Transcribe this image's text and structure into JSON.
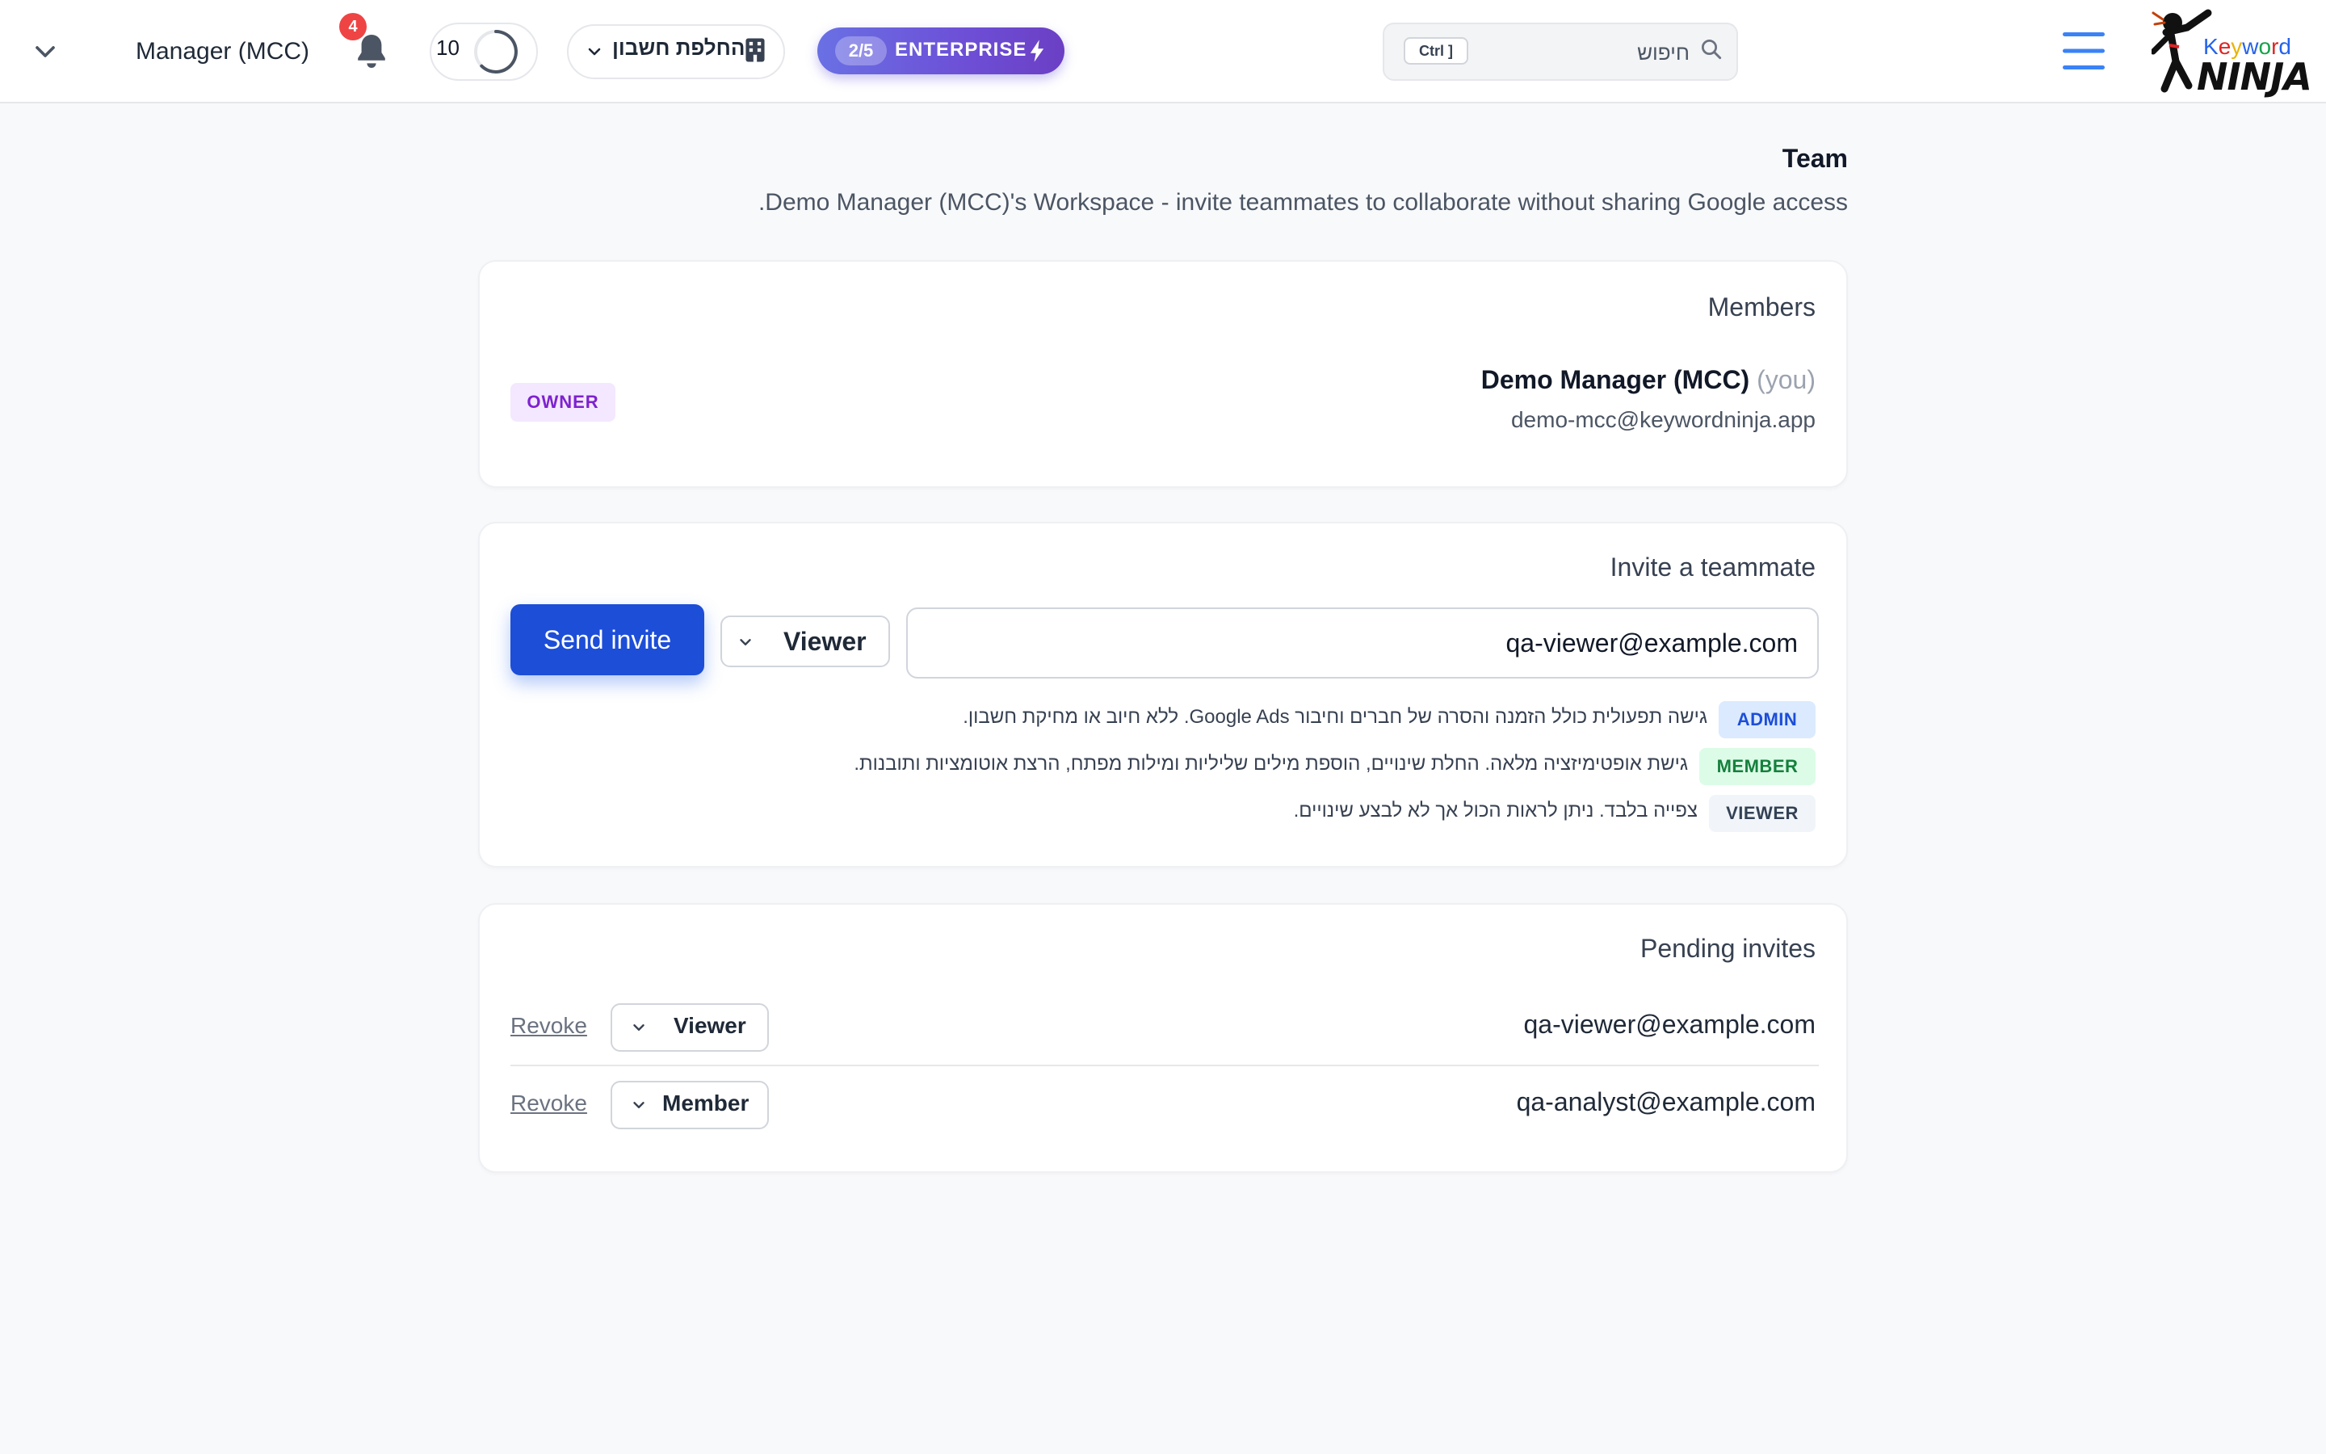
{
  "header": {
    "account_name": "Manager (MCC)",
    "notification_count": "4",
    "credits_value": "10",
    "switch_account_label": "החלפת חשבון",
    "plan_usage": "2/5",
    "plan_name": "ENTERPRISE",
    "search": {
      "placeholder": "חיפוש",
      "shortcut": "Ctrl ]"
    },
    "logo": {
      "word_top": "Keyword",
      "word_bottom": "NINJA"
    },
    "icons": {
      "account": "chevron-down-icon",
      "notifications": "bell-icon",
      "credits": "progress-ring-icon",
      "switch": "building-icon",
      "plan": "lightning-icon",
      "search": "search-icon",
      "menu": "hamburger-icon"
    },
    "colors": {
      "plan_gradient_start": "#6a70e4",
      "plan_gradient_end": "#6b3fc4",
      "badge": "#ef4444",
      "menu": "#2563eb"
    }
  },
  "page": {
    "title": "Team",
    "subtitle": ".Demo Manager (MCC)'s Workspace - invite teammates to collaborate without sharing Google access"
  },
  "members": {
    "title": "Members",
    "items": [
      {
        "name": "Demo Manager (MCC)",
        "you_label": "(you)",
        "email": "demo-mcc@keywordninja.app",
        "role": "OWNER"
      }
    ]
  },
  "invite": {
    "title": "Invite a teammate",
    "email_value": "qa-viewer@example.com",
    "role_selected": "Viewer",
    "send_label": "Send invite",
    "roles": [
      {
        "badge": "ADMIN",
        "description": "גישה תפעולית כולל הזמנה והסרה של חברים וחיבור Google Ads. ללא חיוב או מחיקת חשבון.",
        "bg": "#dbeafe",
        "fg": "#1d4ed8"
      },
      {
        "badge": "MEMBER",
        "description": "גישת אופטימיזציה מלאה. החלת שינויים, הוספת מילים שליליות ומילות מפתח, הרצת אוטומציות ותובנות.",
        "bg": "#dcfce7",
        "fg": "#15803d"
      },
      {
        "badge": "VIEWER",
        "description": "צפייה בלבד. ניתן לראות הכול אך לא לבצע שינויים.",
        "bg": "#f1f5f9",
        "fg": "#334155"
      }
    ]
  },
  "pending": {
    "title": "Pending invites",
    "revoke_label": "Revoke",
    "items": [
      {
        "email": "qa-viewer@example.com",
        "role": "Viewer"
      },
      {
        "email": "qa-analyst@example.com",
        "role": "Member"
      }
    ]
  }
}
